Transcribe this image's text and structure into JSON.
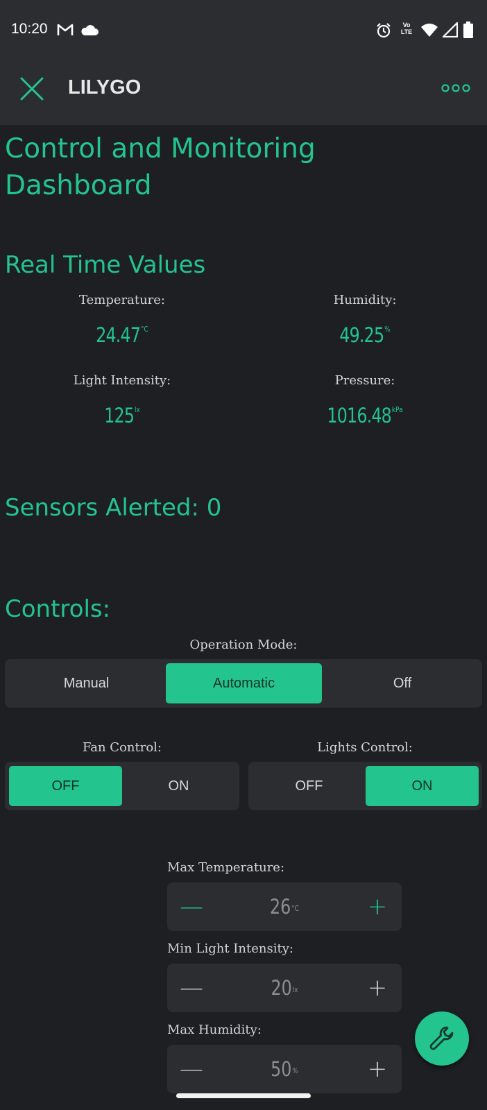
{
  "status_bar": {
    "time": "10:20",
    "network_label": "Vo LTE"
  },
  "app_bar": {
    "title": "LILYGO"
  },
  "dashboard": {
    "heading": "Control and Monitoring Dashboard",
    "realtime_heading": "Real Time Values",
    "temperature": {
      "label": "Temperature:",
      "value": "24.47",
      "unit": "°C"
    },
    "humidity": {
      "label": "Humidity:",
      "value": "49.25",
      "unit": "%"
    },
    "light": {
      "label": "Light Intensity:",
      "value": "125",
      "unit": "lx"
    },
    "pressure": {
      "label": "Pressure:",
      "value": "1016.48",
      "unit": "kPa"
    },
    "alerts": "Sensors Alerted: 0",
    "controls_heading": "Controls:",
    "operation_mode": {
      "label": "Operation Mode:",
      "options": [
        "Manual",
        "Automatic",
        "Off"
      ],
      "selected": "Automatic"
    },
    "fan_control": {
      "label": "Fan Control:",
      "off": "OFF",
      "on": "ON",
      "selected": "OFF"
    },
    "lights_control": {
      "label": "Lights Control:",
      "off": "OFF",
      "on": "ON",
      "selected": "ON"
    },
    "max_temperature": {
      "label": "Max Temperature:",
      "value": "26",
      "unit": "°C",
      "minus": "—",
      "plus": "+"
    },
    "min_light": {
      "label": "Min Light Intensity:",
      "value": "20",
      "unit": "lx",
      "minus": "—",
      "plus": "+"
    },
    "max_humidity": {
      "label": "Max Humidity:",
      "value": "50",
      "unit": "%",
      "minus": "—",
      "plus": "+"
    }
  },
  "icons": {
    "close": "close-icon",
    "more": "more-icon",
    "settings": "wrench-icon",
    "gmail": "gmail-icon",
    "cloud": "cloud-icon",
    "alarm": "alarm-icon",
    "wifi": "wifi-icon",
    "signal": "signal-icon",
    "battery": "battery-icon"
  },
  "colors": {
    "accent": "#24c48e",
    "background": "#1d1f22",
    "surface": "#2c2d31"
  }
}
